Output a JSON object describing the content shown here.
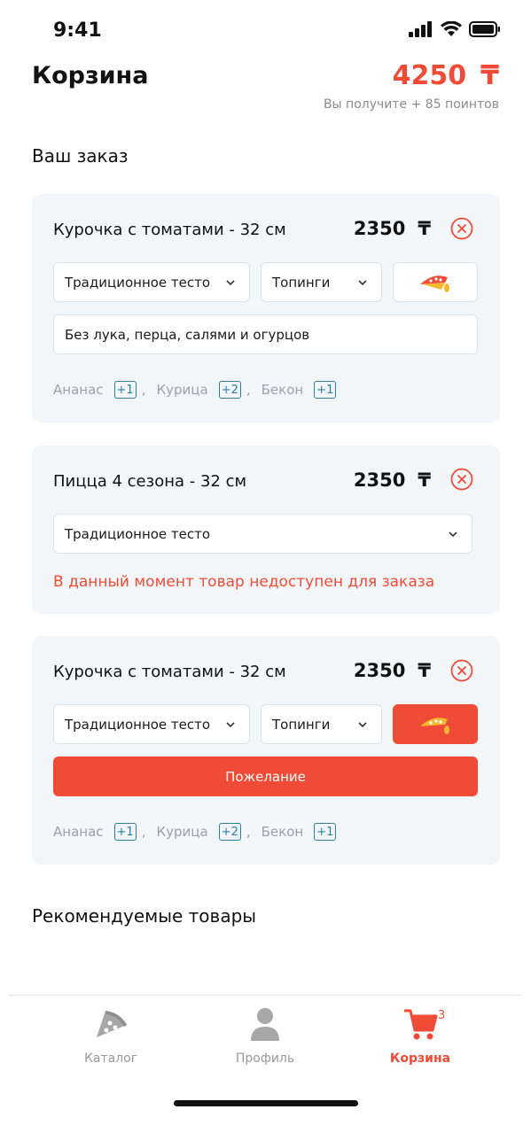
{
  "status": {
    "time": "9:41"
  },
  "header": {
    "title": "Корзина",
    "total": "4250",
    "currency": "₸",
    "points": "Вы получите + 85 поинтов"
  },
  "order_section_title": "Ваш заказ",
  "items": [
    {
      "title": "Курочка с томатами - 32 см",
      "price": "2350",
      "dough": "Традиционное тесто",
      "toppings_label": "Топинги",
      "note": "Без лука, перца, салями и огурцов",
      "toppings": [
        {
          "name": "Ананас",
          "qty": "+1"
        },
        {
          "name": "Курица",
          "qty": "+2"
        },
        {
          "name": "Бекон",
          "qty": "+1"
        }
      ]
    },
    {
      "title": "Пицца 4 сезона - 32 см",
      "price": "2350",
      "dough": "Традиционное тесто",
      "unavailable": "В данный момент товар недоступен для заказа"
    },
    {
      "title": "Курочка с томатами - 32 см",
      "price": "2350",
      "dough": "Традиционное тесто",
      "toppings_label": "Топинги",
      "wish_label": "Пожелание",
      "toppings": [
        {
          "name": "Ананас",
          "qty": "+1"
        },
        {
          "name": "Курица",
          "qty": "+2"
        },
        {
          "name": "Бекон",
          "qty": "+1"
        }
      ]
    }
  ],
  "recommended_title": "Рекомендуемые товары",
  "tabs": [
    {
      "label": "Каталог",
      "icon": "pizza-icon"
    },
    {
      "label": "Профиль",
      "icon": "profile-icon"
    },
    {
      "label": "Корзина",
      "icon": "cart-icon",
      "badge": "3"
    }
  ],
  "colors": {
    "accent": "#ef4b36",
    "card_bg": "#f3f6f9",
    "badge": "#2a7fa3"
  }
}
